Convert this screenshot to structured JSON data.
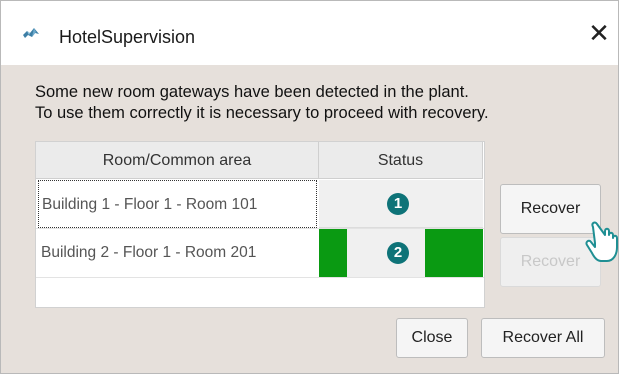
{
  "window": {
    "title": "HotelSupervision",
    "app_icon": "hotel-app-icon",
    "close_glyph": "✕"
  },
  "message": {
    "line1": "Some new room gateways have been detected in the plant.",
    "line2": "To use them correctly it is necessary to proceed with recovery."
  },
  "table": {
    "headers": [
      "Room/Common area",
      "Status"
    ],
    "rows": [
      {
        "room": "Building 1 - Floor 1 - Room 101",
        "badge": "1",
        "status_color": "none"
      },
      {
        "room": "Building 2 - Floor 1 - Room 201",
        "badge": "2",
        "status_color": "#0a9a12"
      }
    ]
  },
  "buttons": {
    "recover_row1": "Recover",
    "recover_row2": "Recover",
    "close": "Close",
    "recover_all": "Recover All"
  },
  "colors": {
    "status_green": "#0a9a12",
    "badge_teal": "#0e7378",
    "dialog_bg": "#e6e0db"
  }
}
